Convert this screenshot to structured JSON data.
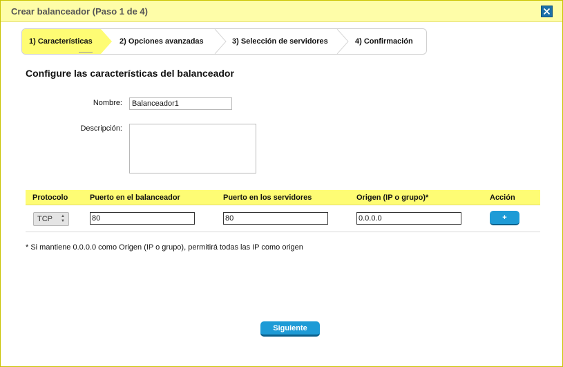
{
  "dialog": {
    "title": "Crear balanceador (Paso 1 de 4)",
    "close_icon": "close-icon"
  },
  "steps": [
    {
      "label": "1) Características",
      "active": true
    },
    {
      "label": "2) Opciones avanzadas",
      "active": false
    },
    {
      "label": "3) Selección de servidores",
      "active": false
    },
    {
      "label": "4) Confirmación",
      "active": false
    }
  ],
  "form": {
    "heading": "Configure las características del balanceador",
    "name_label": "Nombre:",
    "name_value": "Balanceador1",
    "description_label": "Descripción:",
    "description_value": ""
  },
  "rules": {
    "headers": {
      "protocol": "Protocolo",
      "lb_port": "Puerto en el balanceador",
      "server_port": "Puerto en los servidores",
      "origin": "Origen (IP o grupo)*",
      "action": "Acción"
    },
    "row": {
      "protocol": "TCP",
      "lb_port": "80",
      "server_port": "80",
      "origin": "0.0.0.0",
      "add_label": "+"
    }
  },
  "footnote": "* Si mantiene 0.0.0.0 como Origen (IP o grupo), permitirá todas las IP como origen",
  "footer": {
    "next_label": "Siguiente"
  },
  "colors": {
    "accent_yellow": "#fefc74",
    "title_bar": "#fefda8",
    "button_blue": "#1e9bd6"
  }
}
